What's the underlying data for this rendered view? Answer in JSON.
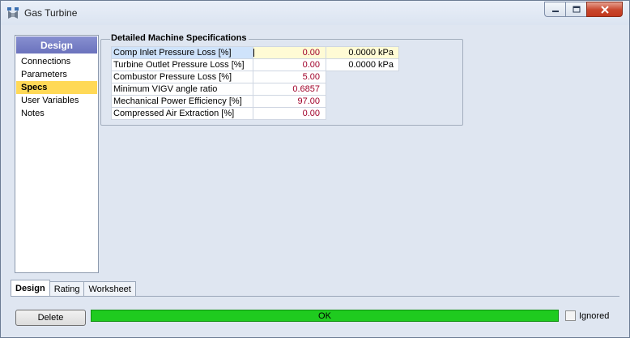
{
  "window": {
    "title": "Gas Turbine"
  },
  "nav": {
    "header": "Design",
    "items": [
      {
        "label": "Connections",
        "selected": false
      },
      {
        "label": "Parameters",
        "selected": false
      },
      {
        "label": "Specs",
        "selected": true
      },
      {
        "label": "User Variables",
        "selected": false
      },
      {
        "label": "Notes",
        "selected": false
      }
    ]
  },
  "specs": {
    "title": "Detailed Machine Specifications",
    "rows": [
      {
        "label": "Comp Inlet Pressure Loss [%]",
        "value": "0.00",
        "extra": "0.0000 kPa"
      },
      {
        "label": "Turbine Outlet Pressure Loss [%]",
        "value": "0.00",
        "extra": "0.0000 kPa"
      },
      {
        "label": "Combustor Pressure Loss [%]",
        "value": "5.00"
      },
      {
        "label": "Minimum VIGV angle ratio",
        "value": "0.6857"
      },
      {
        "label": "Mechanical Power Efficiency [%]",
        "value": "97.00"
      },
      {
        "label": "Compressed Air Extraction [%]",
        "value": "0.00"
      }
    ]
  },
  "tabs": [
    {
      "label": "Design",
      "active": true
    },
    {
      "label": "Rating",
      "active": false
    },
    {
      "label": "Worksheet",
      "active": false
    }
  ],
  "footer": {
    "delete_label": "Delete",
    "status": "OK",
    "status_color": "#1fcb1f",
    "ignored_label": "Ignored",
    "ignored_checked": false
  },
  "colors": {
    "nav_header": "#6b72bd",
    "selected_item": "#ffd957",
    "value_text": "#a00029"
  }
}
